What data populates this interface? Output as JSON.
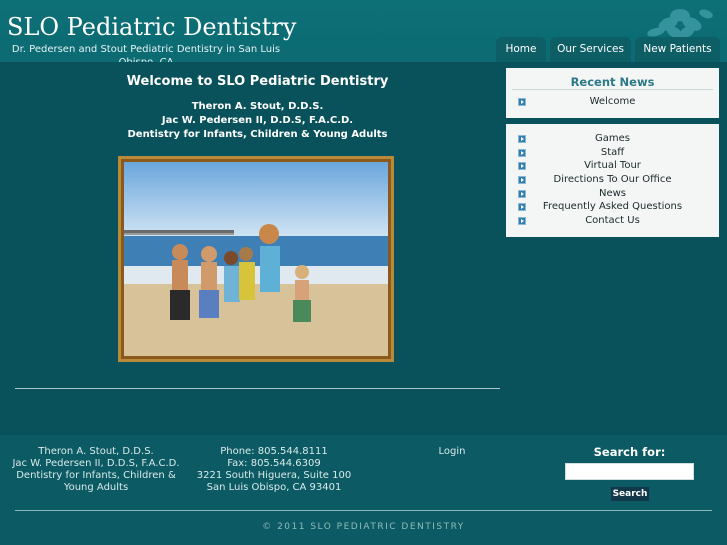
{
  "header": {
    "title": "SLO Pediatric Dentistry",
    "subtitle": "Dr. Pedersen and Stout Pediatric Dentistry in San Luis Obispo, CA",
    "logo_icon": "flower-icon"
  },
  "nav": {
    "tabs": [
      {
        "label": "Home"
      },
      {
        "label": "Our Services"
      },
      {
        "label": "New Patients"
      }
    ]
  },
  "main": {
    "welcome": "Welcome to SLO Pediatric Dentistry",
    "doctor_1": "Theron A. Stout, D.D.S.",
    "doctor_2": "Jac W. Pedersen II, D.D.S, F.A.C.D.",
    "tagline": "Dentistry for Infants, Children & Young Adults"
  },
  "sidebar": {
    "news_title": "Recent News",
    "news_items": [
      {
        "label": "Welcome"
      }
    ],
    "links": [
      {
        "label": "Games"
      },
      {
        "label": "Staff"
      },
      {
        "label": "Virtual Tour"
      },
      {
        "label": "Directions To Our Office"
      },
      {
        "label": "News"
      },
      {
        "label": "Frequently Asked Questions"
      },
      {
        "label": "Contact Us"
      }
    ]
  },
  "footer": {
    "col1": [
      "Theron A. Stout, D.D.S.",
      "Jac W. Pedersen II, D.D.S, F.A.C.D.",
      "Dentistry for Infants, Children &",
      "Young Adults"
    ],
    "col2": [
      "Phone: 805.544.8111",
      "Fax: 805.544.6309",
      "3221 South Higuera, Suite 100",
      "San Luis Obispo, CA 93401"
    ],
    "login": "Login",
    "search_label": "Search for:",
    "search_value": "",
    "search_button": "Search",
    "copyright": "© 2011 SLO PEDIATRIC DENTISTRY"
  },
  "colors": {
    "background": "#0c5a63",
    "panel": "#f4f5f5",
    "accent": "#2b7a86"
  }
}
